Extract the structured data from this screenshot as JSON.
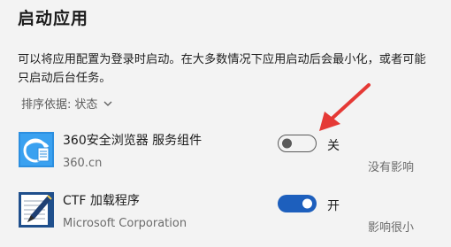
{
  "page": {
    "title": "启动应用"
  },
  "description": "可以将应用配置为登录时启动。在大多数情况下应用启动后会最小化，或者可能只启动后台任务。",
  "sort": {
    "label": "排序依据:",
    "value": "状态"
  },
  "apps": [
    {
      "name": "360安全浏览器 服务组件",
      "publisher": "360.cn",
      "toggle_on": false,
      "toggle_label": "关",
      "impact": "没有影响",
      "icon": "360-browser-icon"
    },
    {
      "name": "CTF 加载程序",
      "publisher": "Microsoft Corporation",
      "toggle_on": true,
      "toggle_label": "开",
      "impact": "影响很小",
      "icon": "ctf-loader-icon"
    }
  ],
  "colors": {
    "accent": "#1d5fbd",
    "annotation_arrow": "#e53935",
    "background": "#f3f3f3"
  }
}
